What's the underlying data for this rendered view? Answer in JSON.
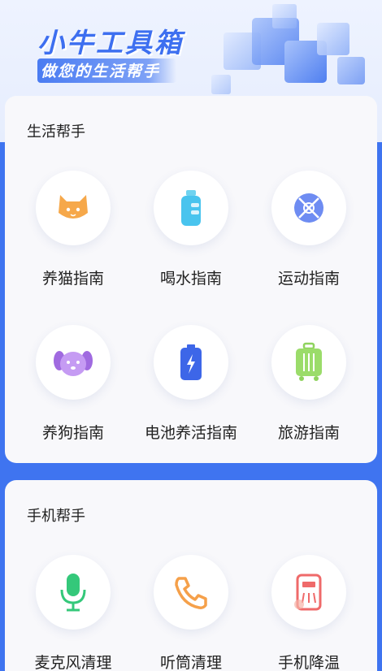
{
  "header": {
    "title": "小牛工具箱",
    "subtitle": "做您的生活帮手"
  },
  "sections": [
    {
      "title": "生活帮手",
      "items": [
        {
          "label": "养猫指南",
          "icon": "cat-icon"
        },
        {
          "label": "喝水指南",
          "icon": "water-bottle-icon"
        },
        {
          "label": "运动指南",
          "icon": "sports-ball-icon"
        },
        {
          "label": "养狗指南",
          "icon": "dog-icon"
        },
        {
          "label": "电池养活指南",
          "icon": "battery-icon"
        },
        {
          "label": "旅游指南",
          "icon": "luggage-icon"
        }
      ]
    },
    {
      "title": "手机帮手",
      "items": [
        {
          "label": "麦克风清理",
          "icon": "microphone-icon"
        },
        {
          "label": "听筒清理",
          "icon": "phone-receiver-icon"
        },
        {
          "label": "手机降温",
          "icon": "phone-cooling-icon"
        }
      ]
    }
  ],
  "colors": {
    "brand_blue": "#3f74f0",
    "card_bg": "#f8f8fb"
  }
}
